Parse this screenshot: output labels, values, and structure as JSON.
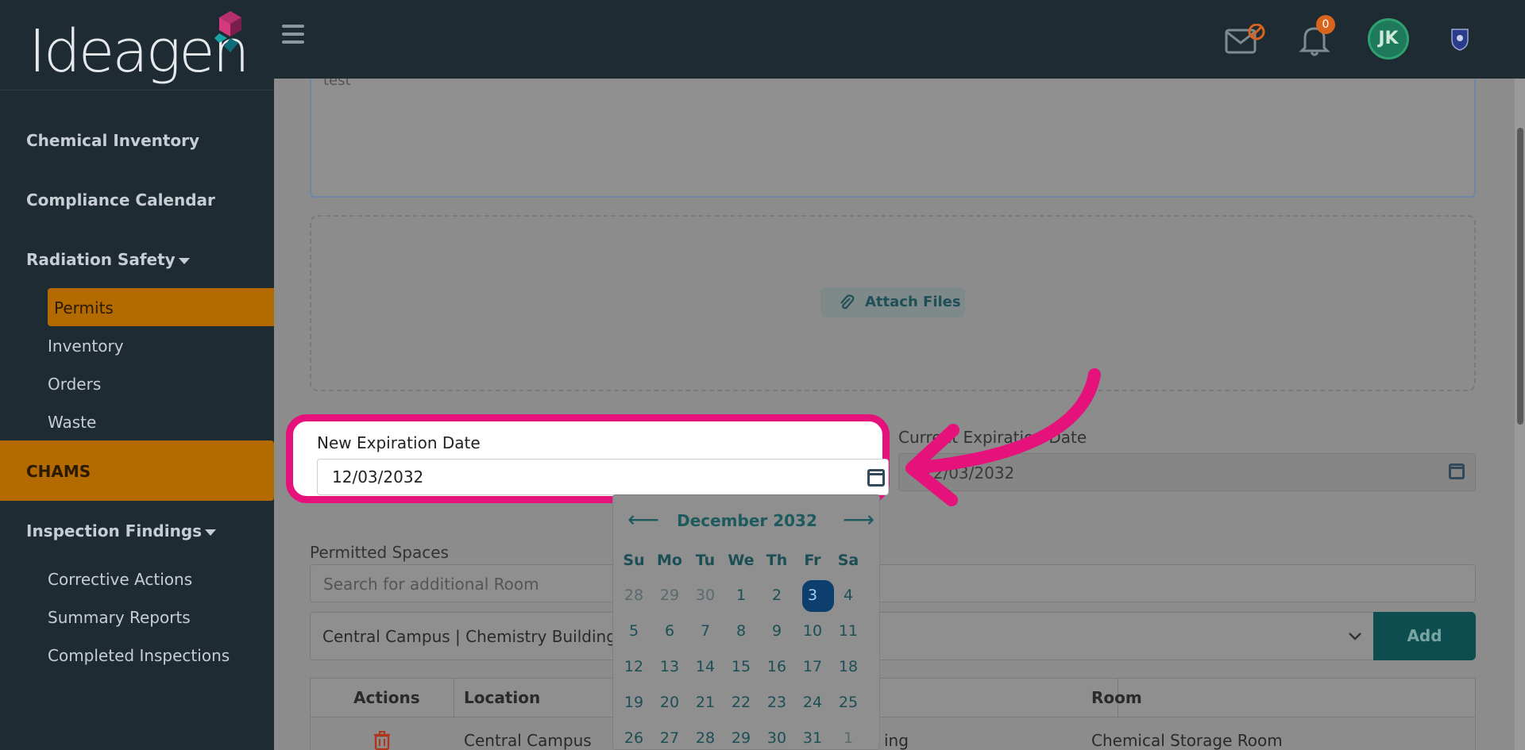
{
  "brand": {
    "logo_text": "Ideagen"
  },
  "sidebar": {
    "items": [
      {
        "label": "Chemical Inventory"
      },
      {
        "label": "Compliance Calendar"
      },
      {
        "label": "Radiation Safety"
      },
      {
        "label": "Permits"
      },
      {
        "label": "Inventory"
      },
      {
        "label": "Orders"
      },
      {
        "label": "Waste"
      },
      {
        "label": "CHAMS"
      },
      {
        "label": "Inspection Findings"
      },
      {
        "label": "Corrective Actions"
      },
      {
        "label": "Summary Reports"
      },
      {
        "label": "Completed Inspections"
      }
    ]
  },
  "topbar": {
    "notifications_count": "0",
    "avatar_initials": "JK"
  },
  "form": {
    "textarea_value": "test",
    "attach_label": "Attach Files",
    "new_expiration_label": "New Expiration Date",
    "new_expiration_value": "12/03/2032",
    "current_expiration_label": "Current Expiration Date",
    "current_expiration_value": "12/03/2032",
    "permitted_spaces_label": "Permitted Spaces",
    "room_search_placeholder": "Search for additional Room",
    "room_select_value": "Central Campus | Chemistry Building: I",
    "add_label": "Add"
  },
  "datepicker": {
    "month_label": "December 2032",
    "weekdays": [
      "Su",
      "Mo",
      "Tu",
      "We",
      "Th",
      "Fr",
      "Sa"
    ],
    "weeks": [
      [
        "28",
        "29",
        "30",
        "1",
        "2",
        "3",
        "4"
      ],
      [
        "5",
        "6",
        "7",
        "8",
        "9",
        "10",
        "11"
      ],
      [
        "12",
        "13",
        "14",
        "15",
        "16",
        "17",
        "18"
      ],
      [
        "19",
        "20",
        "21",
        "22",
        "23",
        "24",
        "25"
      ],
      [
        "26",
        "27",
        "28",
        "29",
        "30",
        "31",
        "1"
      ]
    ],
    "selected_day": "3"
  },
  "table": {
    "headers": [
      "Actions",
      "Location",
      "Room"
    ],
    "row": {
      "location": "Central Campus",
      "building_suffix": "ing",
      "room": "Chemical Storage Room"
    }
  },
  "colors": {
    "highlight": "#e4127a",
    "sidebar_bg": "#1f2b33",
    "accent_orange": "#b36a00",
    "teal": "#0e4d4f"
  }
}
